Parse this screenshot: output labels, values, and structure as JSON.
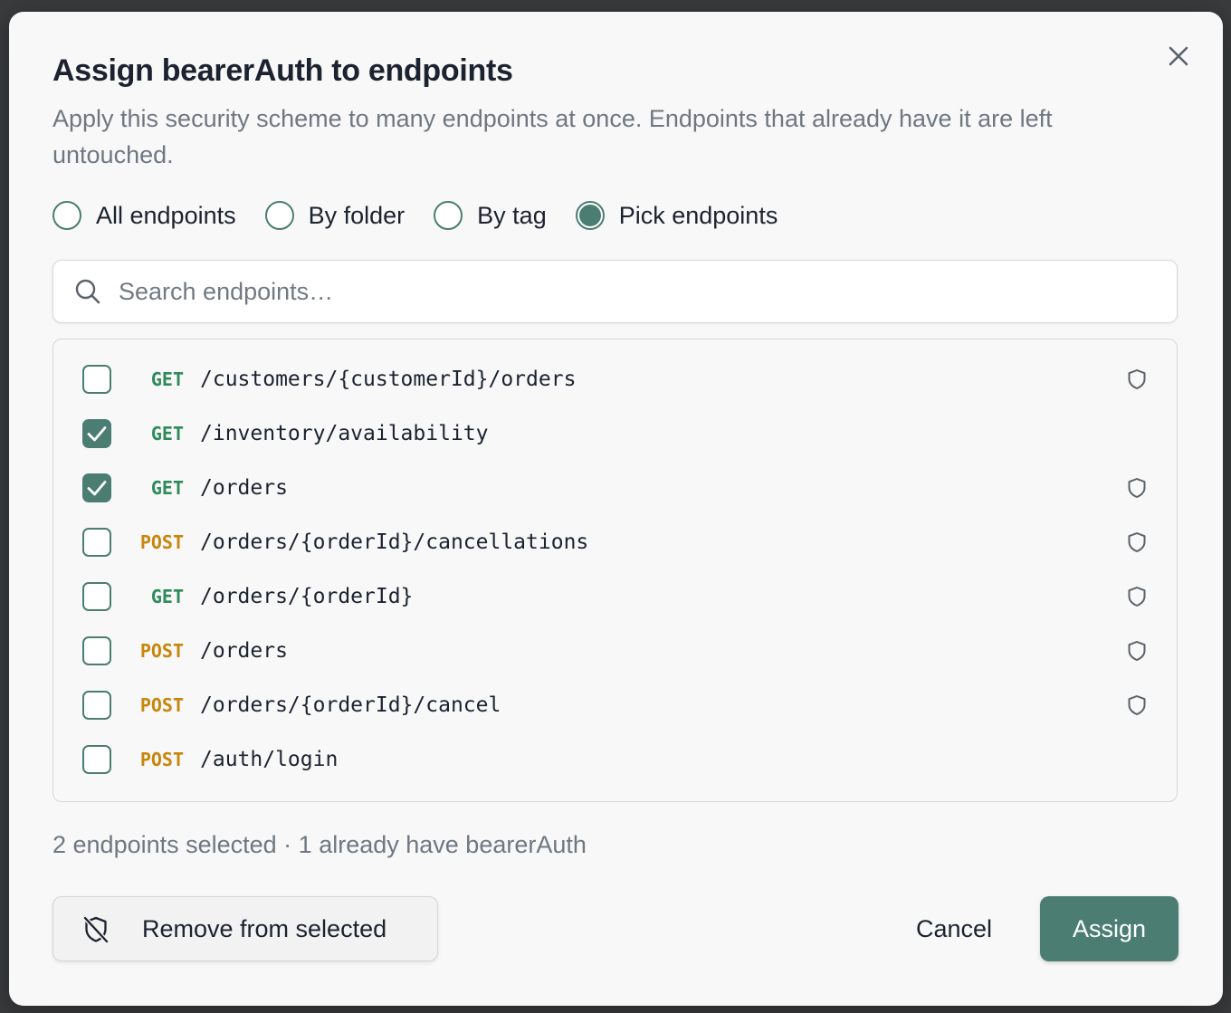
{
  "dialog": {
    "title": "Assign bearerAuth to endpoints",
    "subtitle": "Apply this security scheme to many endpoints at once. Endpoints that already have it are left untouched."
  },
  "scope_options": [
    {
      "label": "All endpoints",
      "selected": false
    },
    {
      "label": "By folder",
      "selected": false
    },
    {
      "label": "By tag",
      "selected": false
    },
    {
      "label": "Pick endpoints",
      "selected": true
    }
  ],
  "search": {
    "placeholder": "Search endpoints…",
    "value": ""
  },
  "endpoints": [
    {
      "method": "GET",
      "path": "/customers/{customerId}/orders",
      "checked": false,
      "has_scheme": true
    },
    {
      "method": "GET",
      "path": "/inventory/availability",
      "checked": true,
      "has_scheme": false
    },
    {
      "method": "GET",
      "path": "/orders",
      "checked": true,
      "has_scheme": true
    },
    {
      "method": "POST",
      "path": "/orders/{orderId}/cancellations",
      "checked": false,
      "has_scheme": true
    },
    {
      "method": "GET",
      "path": "/orders/{orderId}",
      "checked": false,
      "has_scheme": true
    },
    {
      "method": "POST",
      "path": "/orders",
      "checked": false,
      "has_scheme": true
    },
    {
      "method": "POST",
      "path": "/orders/{orderId}/cancel",
      "checked": false,
      "has_scheme": true
    },
    {
      "method": "POST",
      "path": "/auth/login",
      "checked": false,
      "has_scheme": false
    }
  ],
  "summary": "2 endpoints selected · 1 already have bearerAuth",
  "footer": {
    "remove_label": "Remove from selected",
    "cancel_label": "Cancel",
    "assign_label": "Assign"
  },
  "icons": {
    "close": "close-icon",
    "search": "search-icon",
    "shield": "shield-icon",
    "shield_off": "shield-off-icon",
    "check": "check-icon"
  },
  "colors": {
    "accent": "#4b7d72",
    "get_method": "#2f8a5c",
    "post_method": "#c9860c",
    "title_text": "#1d2230",
    "muted_text": "#707782"
  }
}
